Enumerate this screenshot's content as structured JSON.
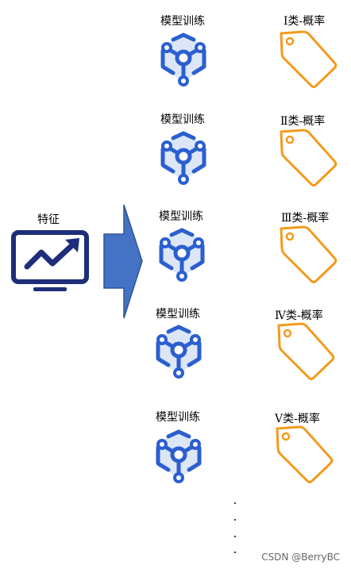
{
  "feature": {
    "label": "特征",
    "icon": "chart-monitor-icon",
    "color": "#1F2E7A"
  },
  "arrow": {
    "color": "#4472C4",
    "border": "#2F5597"
  },
  "rows": [
    {
      "model_label": "模型训练",
      "tag_label": "Ⅰ类-概率"
    },
    {
      "model_label": "模型训练",
      "tag_label": "Ⅱ类-概率"
    },
    {
      "model_label": "模型训练",
      "tag_label": "Ⅲ类-概率"
    },
    {
      "model_label": "模型训练",
      "tag_label": "Ⅳ类-概率"
    },
    {
      "model_label": "模型训练",
      "tag_label": "Ⅴ类-概率"
    }
  ],
  "model_icon": {
    "name": "model-cube-icon",
    "color": "#2B5FD0"
  },
  "tag_icon": {
    "name": "price-tag-icon",
    "color": "#F39A1E"
  },
  "watermark": "CSDN @BerryBC"
}
